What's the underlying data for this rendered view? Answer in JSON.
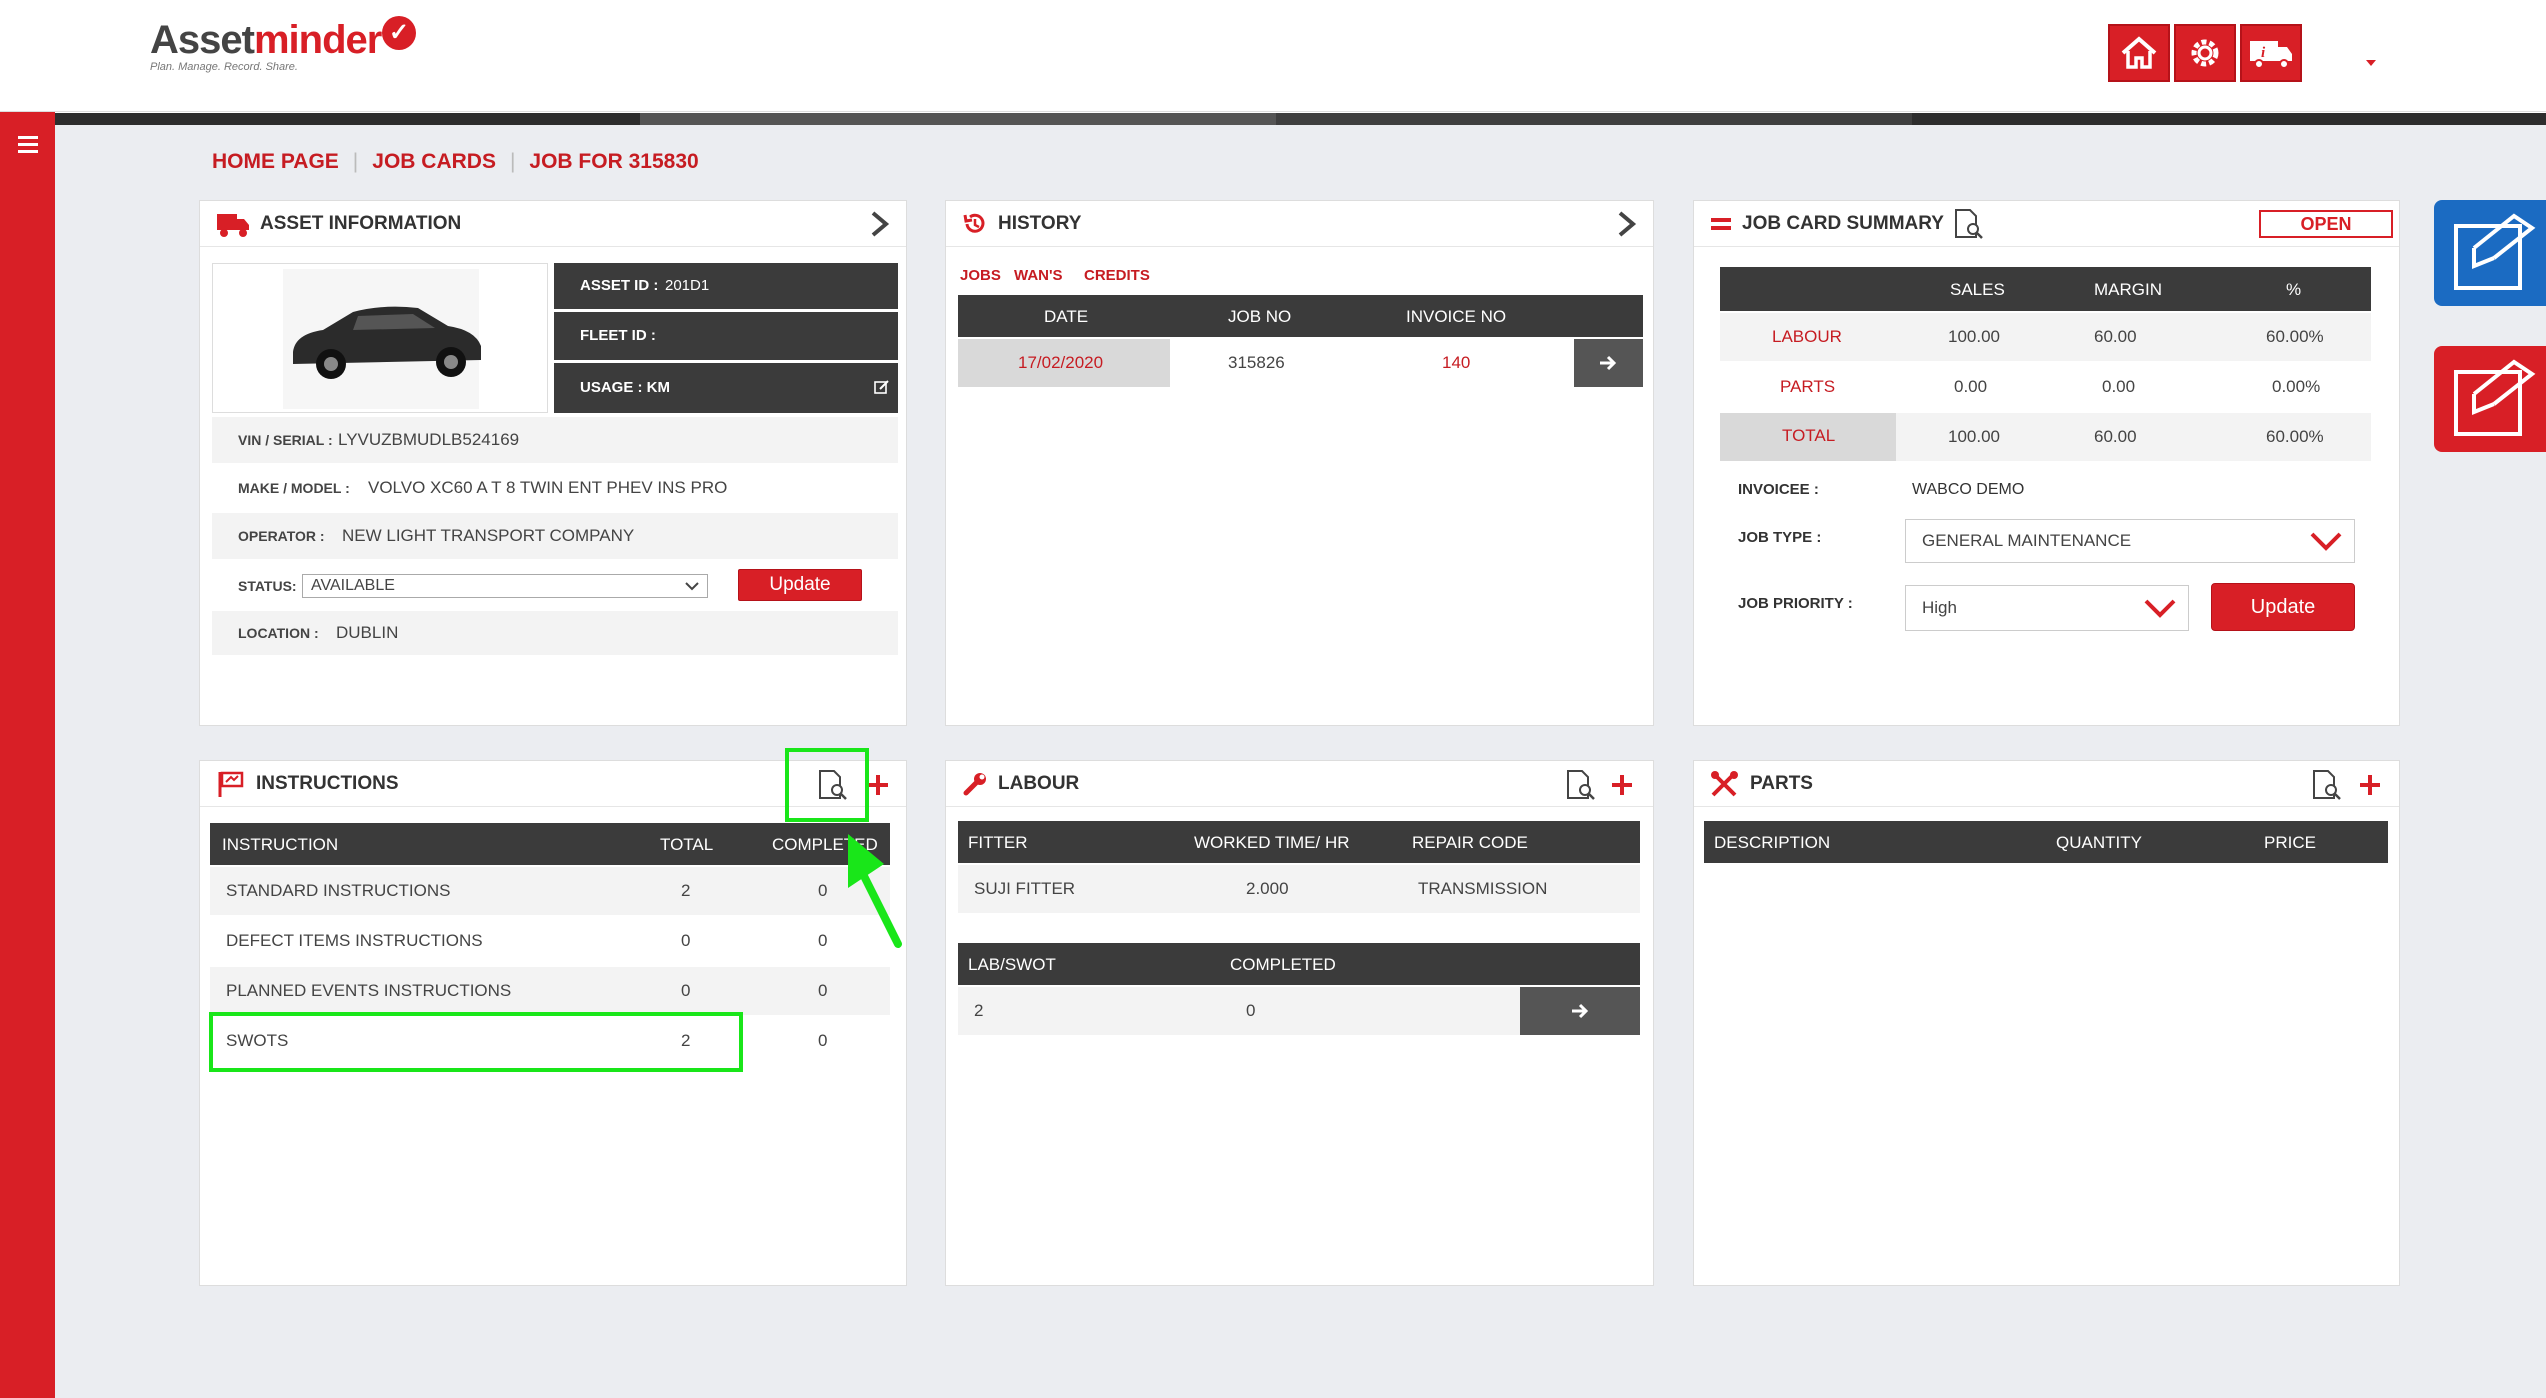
{
  "logo": {
    "part1": "Asset",
    "part2": "minder",
    "tagline": "Plan. Manage. Record. Share."
  },
  "colors": {
    "brand_red": "#d81f26",
    "dark": "#3b3b3b",
    "highlight_green": "#19e619"
  },
  "header_icons": [
    "home-icon",
    "settings-icon",
    "truck-info-icon"
  ],
  "breadcrumb": {
    "home": "HOME PAGE",
    "job_cards": "JOB CARDS",
    "job": "JOB FOR 315830"
  },
  "asset": {
    "title": "ASSET INFORMATION",
    "asset_id_label": "ASSET ID :",
    "asset_id": "201D1",
    "fleet_id_label": "FLEET ID :",
    "usage_label": "USAGE : KM",
    "vin_label": "VIN / SERIAL :",
    "vin": "LYVUZBMUDLB524169",
    "make_label": "MAKE / MODEL :",
    "make": "VOLVO XC60 A T 8 TWIN ENT PHEV INS PRO",
    "operator_label": "OPERATOR :",
    "operator": "NEW LIGHT TRANSPORT COMPANY",
    "status_label": "STATUS:",
    "status": "AVAILABLE",
    "update": "Update",
    "location_label": "LOCATION :",
    "location": "DUBLIN"
  },
  "history": {
    "title": "HISTORY",
    "tabs": [
      "JOBS",
      "WAN'S",
      "CREDITS"
    ],
    "headers": [
      "DATE",
      "JOB NO",
      "INVOICE NO"
    ],
    "rows": [
      {
        "date": "17/02/2020",
        "job_no": "315826",
        "invoice_no": "140"
      }
    ]
  },
  "summary": {
    "title": "JOB CARD SUMMARY",
    "status": "OPEN",
    "headers": [
      "SALES",
      "MARGIN",
      "%"
    ],
    "rows": [
      {
        "label": "LABOUR",
        "sales": "100.00",
        "margin": "60.00",
        "pct": "60.00%"
      },
      {
        "label": "PARTS",
        "sales": "0.00",
        "margin": "0.00",
        "pct": "0.00%"
      },
      {
        "label": "TOTAL",
        "sales": "100.00",
        "margin": "60.00",
        "pct": "60.00%"
      }
    ],
    "invoicee_label": "INVOICEE :",
    "invoicee": "WABCO DEMO",
    "job_type_label": "JOB TYPE :",
    "job_type": "GENERAL MAINTENANCE",
    "priority_label": "JOB PRIORITY :",
    "priority": "High",
    "update": "Update"
  },
  "instructions": {
    "title": "INSTRUCTIONS",
    "headers": [
      "INSTRUCTION",
      "TOTAL",
      "COMPLETED"
    ],
    "rows": [
      {
        "name": "STANDARD INSTRUCTIONS",
        "total": "2",
        "completed": "0"
      },
      {
        "name": "DEFECT ITEMS INSTRUCTIONS",
        "total": "0",
        "completed": "0"
      },
      {
        "name": "PLANNED EVENTS INSTRUCTIONS",
        "total": "0",
        "completed": "0"
      },
      {
        "name": "SWOTS",
        "total": "2",
        "completed": "0"
      }
    ]
  },
  "labour": {
    "title": "LABOUR",
    "headers": [
      "FITTER",
      "WORKED TIME/ HR",
      "REPAIR CODE"
    ],
    "row": {
      "fitter": "SUJI FITTER",
      "time": "2.000",
      "code": "TRANSMISSION"
    },
    "swot_headers": [
      "LAB/SWOT",
      "COMPLETED"
    ],
    "swot_row": {
      "lab": "2",
      "completed": "0"
    }
  },
  "parts": {
    "title": "PARTS",
    "headers": [
      "DESCRIPTION",
      "QUANTITY",
      "PRICE"
    ]
  }
}
